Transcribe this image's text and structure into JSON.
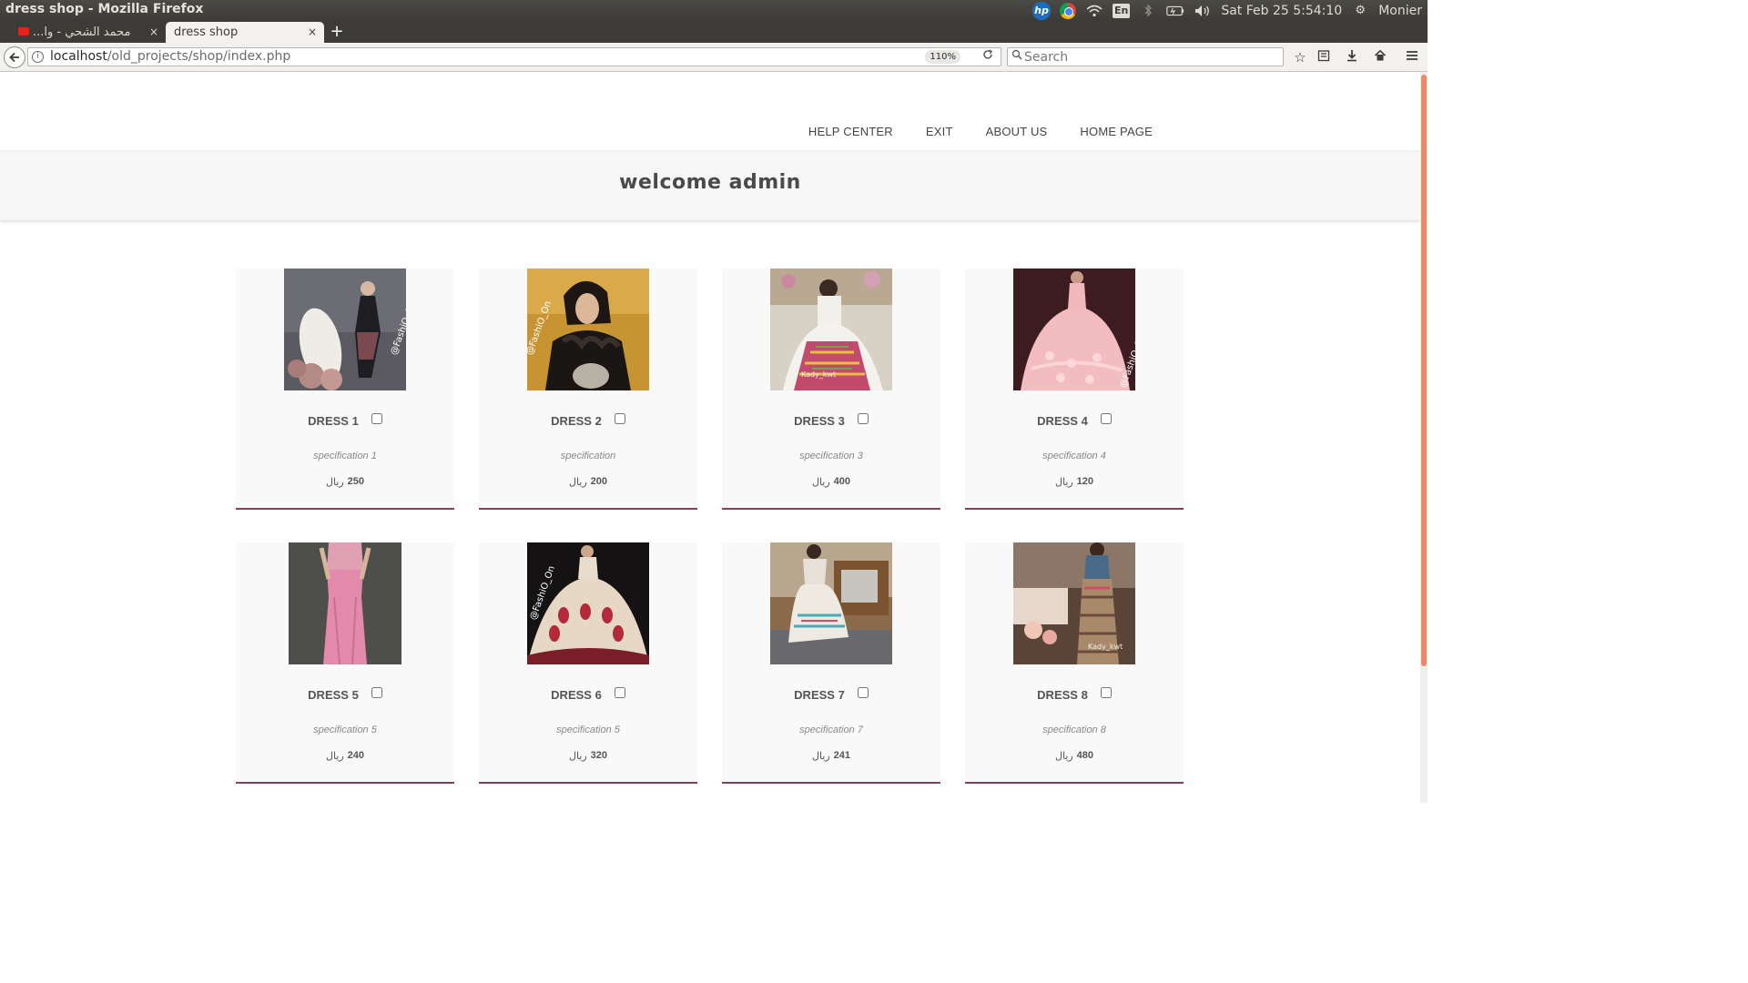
{
  "os": {
    "window_title": "dress shop - Mozilla Firefox",
    "keyboard_layout": "En",
    "clock": "Sat Feb 25  5:54:10",
    "user": "Monier",
    "hp_label": "hp"
  },
  "browser": {
    "tabs": [
      {
        "label": "...محمد الشحي - وا",
        "active": false
      },
      {
        "label": "dress shop",
        "active": true
      }
    ],
    "close_glyph": "×",
    "new_tab_glyph": "+",
    "url_host": "localhost",
    "url_path": "/old_projects/shop/index.php",
    "zoom": "110%",
    "search_placeholder": "Search"
  },
  "site": {
    "menu": [
      "HELP CENTER",
      "EXIT",
      "ABOUT US",
      "HOME PAGE"
    ],
    "welcome": "welcome admin",
    "currency": "ريال",
    "accent_color": "#8d3c56",
    "products": [
      {
        "name": "DRESS 1",
        "spec": "specification 1",
        "price": "250"
      },
      {
        "name": "DRESS 2",
        "spec": "specification",
        "price": "200"
      },
      {
        "name": "DRESS 3",
        "spec": "specification 3",
        "price": "400"
      },
      {
        "name": "DRESS 4",
        "spec": "specification 4",
        "price": "120"
      },
      {
        "name": "DRESS 5",
        "spec": "specification 5",
        "price": "240"
      },
      {
        "name": "DRESS 6",
        "spec": "specification 5",
        "price": "320"
      },
      {
        "name": "DRESS 7",
        "spec": "specification 7",
        "price": "241"
      },
      {
        "name": "DRESS 8",
        "spec": "specification 8",
        "price": "480"
      }
    ],
    "watermarks": [
      "@FashiO_On",
      "@FashiO_On",
      "Kady_kwt",
      "@FashiO_On",
      "@FashiO_On",
      "Kady_kwt"
    ]
  }
}
